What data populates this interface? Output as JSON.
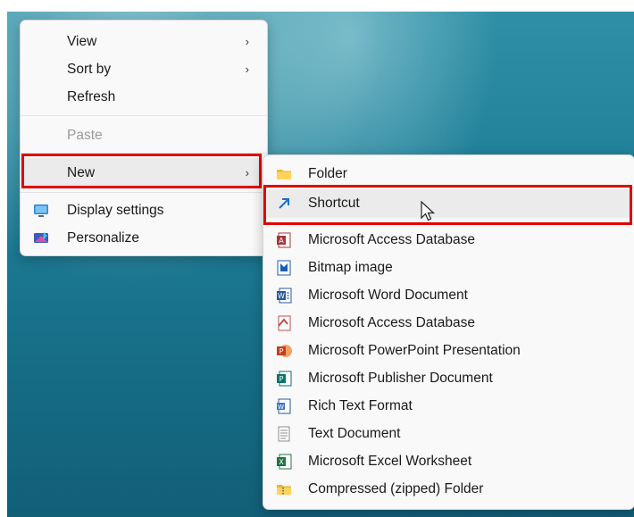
{
  "context_menu": {
    "items": [
      {
        "label": "View",
        "has_submenu": true
      },
      {
        "label": "Sort by",
        "has_submenu": true
      },
      {
        "label": "Refresh"
      },
      {
        "label": "Paste",
        "disabled": true
      },
      {
        "label": "New",
        "has_submenu": true,
        "highlighted": true
      },
      {
        "label": "Display settings",
        "icon": "display-icon"
      },
      {
        "label": "Personalize",
        "icon": "personalize-icon"
      }
    ],
    "submenu_chevron": "›"
  },
  "new_submenu": {
    "items": [
      {
        "label": "Folder",
        "icon": "folder-icon"
      },
      {
        "label": "Shortcut",
        "icon": "shortcut-icon",
        "highlighted": true
      },
      {
        "label": "Microsoft Access Database",
        "icon": "access-icon"
      },
      {
        "label": "Bitmap image",
        "icon": "bitmap-icon"
      },
      {
        "label": "Microsoft Word Document",
        "icon": "word-icon"
      },
      {
        "label": "Microsoft Access Database",
        "icon": "access-icon"
      },
      {
        "label": "Microsoft PowerPoint Presentation",
        "icon": "powerpoint-icon"
      },
      {
        "label": "Microsoft Publisher Document",
        "icon": "publisher-icon"
      },
      {
        "label": "Rich Text Format",
        "icon": "rtf-icon"
      },
      {
        "label": "Text Document",
        "icon": "text-document-icon"
      },
      {
        "label": "Microsoft Excel Worksheet",
        "icon": "excel-icon"
      },
      {
        "label": "Compressed (zipped) Folder",
        "icon": "zip-folder-icon"
      }
    ]
  },
  "colors": {
    "highlight_border": "#e00000",
    "menu_background": "#f9f9f9",
    "desktop_water": "#1f7f98"
  }
}
